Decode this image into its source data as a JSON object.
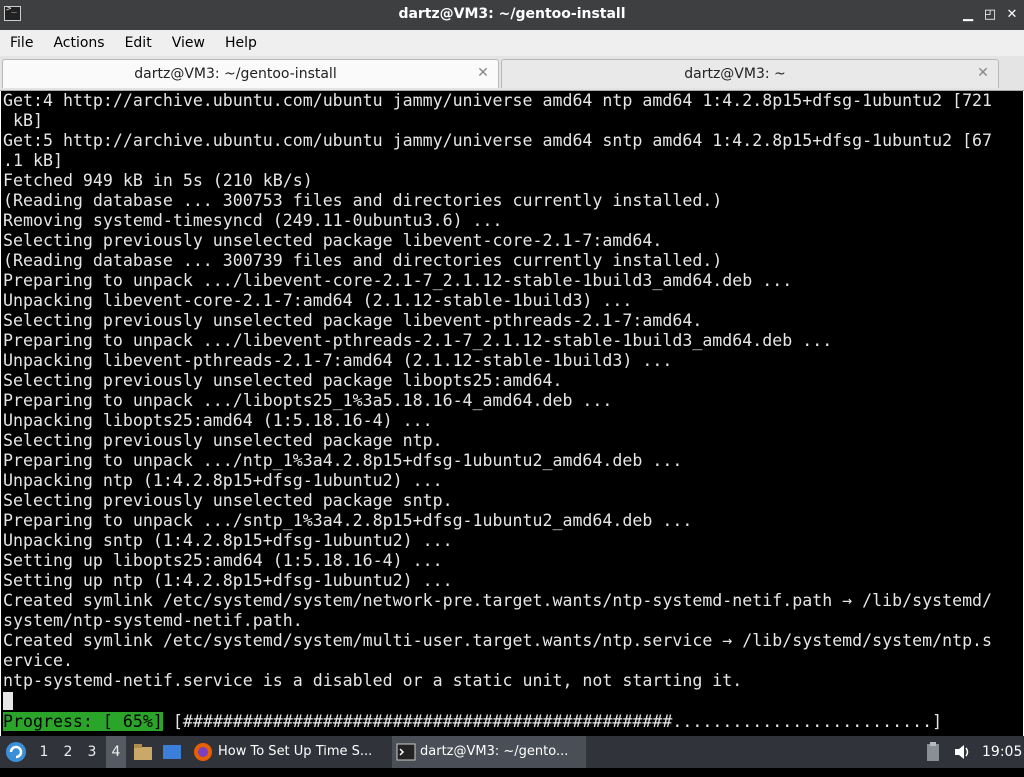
{
  "window": {
    "title": "dartz@VM3: ~/gentoo-install",
    "minimize_label": "▁",
    "restore_label": "◰",
    "close_label": "✕"
  },
  "menu": {
    "items": [
      "File",
      "Actions",
      "Edit",
      "View",
      "Help"
    ]
  },
  "tabs": [
    {
      "label": "dartz@VM3: ~/gentoo-install",
      "close": "✕",
      "active": true
    },
    {
      "label": "dartz@VM3: ~",
      "close": "✕",
      "active": false
    }
  ],
  "terminal": {
    "lines": [
      "Get:4 http://archive.ubuntu.com/ubuntu jammy/universe amd64 ntp amd64 1:4.2.8p15+dfsg-1ubuntu2 [721",
      " kB]",
      "Get:5 http://archive.ubuntu.com/ubuntu jammy/universe amd64 sntp amd64 1:4.2.8p15+dfsg-1ubuntu2 [67",
      ".1 kB]",
      "Fetched 949 kB in 5s (210 kB/s)",
      "(Reading database ... 300753 files and directories currently installed.)",
      "Removing systemd-timesyncd (249.11-0ubuntu3.6) ...",
      "Selecting previously unselected package libevent-core-2.1-7:amd64.",
      "(Reading database ... 300739 files and directories currently installed.)",
      "Preparing to unpack .../libevent-core-2.1-7_2.1.12-stable-1build3_amd64.deb ...",
      "Unpacking libevent-core-2.1-7:amd64 (2.1.12-stable-1build3) ...",
      "Selecting previously unselected package libevent-pthreads-2.1-7:amd64.",
      "Preparing to unpack .../libevent-pthreads-2.1-7_2.1.12-stable-1build3_amd64.deb ...",
      "Unpacking libevent-pthreads-2.1-7:amd64 (2.1.12-stable-1build3) ...",
      "Selecting previously unselected package libopts25:amd64.",
      "Preparing to unpack .../libopts25_1%3a5.18.16-4_amd64.deb ...",
      "Unpacking libopts25:amd64 (1:5.18.16-4) ...",
      "Selecting previously unselected package ntp.",
      "Preparing to unpack .../ntp_1%3a4.2.8p15+dfsg-1ubuntu2_amd64.deb ...",
      "Unpacking ntp (1:4.2.8p15+dfsg-1ubuntu2) ...",
      "Selecting previously unselected package sntp.",
      "Preparing to unpack .../sntp_1%3a4.2.8p15+dfsg-1ubuntu2_amd64.deb ...",
      "Unpacking sntp (1:4.2.8p15+dfsg-1ubuntu2) ...",
      "Setting up libopts25:amd64 (1:5.18.16-4) ...",
      "Setting up ntp (1:4.2.8p15+dfsg-1ubuntu2) ...",
      "Created symlink /etc/systemd/system/network-pre.target.wants/ntp-systemd-netif.path → /lib/systemd/",
      "system/ntp-systemd-netif.path.",
      "Created symlink /etc/systemd/system/multi-user.target.wants/ntp.service → /lib/systemd/system/ntp.s",
      "ervice.",
      "ntp-systemd-netif.service is a disabled or a static unit, not starting it."
    ],
    "progress_label": "Progress: [ 65%]",
    "progress_bar": "[#################################################..........................]",
    "progress_value": 0.65
  },
  "taskbar": {
    "workspaces": [
      "1",
      "2",
      "3",
      "4"
    ],
    "current_workspace": "4",
    "tasks": [
      {
        "label": "How To Set Up Time S...",
        "icon": "firefox-icon"
      },
      {
        "label": "dartz@VM3: ~/gento...",
        "icon": "terminal-icon"
      }
    ],
    "clock": "19:05"
  }
}
